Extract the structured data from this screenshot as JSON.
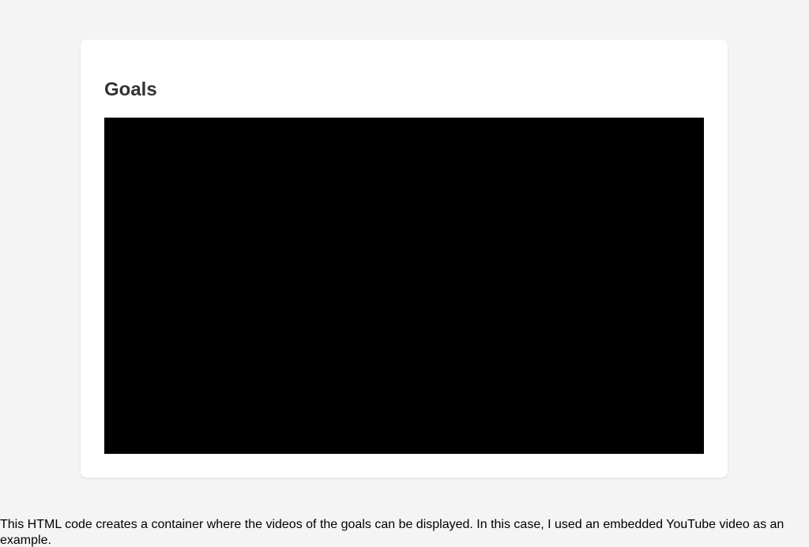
{
  "card": {
    "title": "Goals",
    "video": {
      "background_color": "#000000"
    }
  },
  "footnote": {
    "text": "This HTML code creates a container where the videos of the goals can be displayed. In this case, I used an embedded YouTube video as an example."
  },
  "colors": {
    "page_background": "#f4f4f4",
    "card_background": "#ffffff",
    "title_color": "#333333"
  }
}
